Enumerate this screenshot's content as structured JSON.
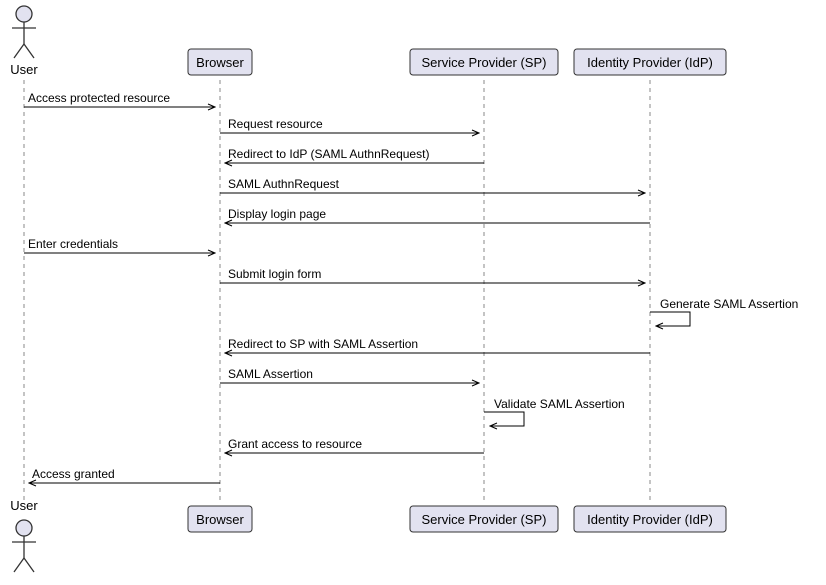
{
  "participants": {
    "user": "User",
    "browser": "Browser",
    "sp": "Service Provider (SP)",
    "idp": "Identity Provider (IdP)"
  },
  "messages": [
    {
      "label": "Access protected resource"
    },
    {
      "label": "Request resource"
    },
    {
      "label": "Redirect to IdP (SAML AuthnRequest)"
    },
    {
      "label": "SAML AuthnRequest"
    },
    {
      "label": "Display login page"
    },
    {
      "label": "Enter credentials"
    },
    {
      "label": "Submit login form"
    },
    {
      "label": "Generate SAML Assertion"
    },
    {
      "label": "Redirect to SP with SAML Assertion"
    },
    {
      "label": "SAML Assertion"
    },
    {
      "label": "Validate SAML Assertion"
    },
    {
      "label": "Grant access to resource"
    },
    {
      "label": "Access granted"
    }
  ]
}
